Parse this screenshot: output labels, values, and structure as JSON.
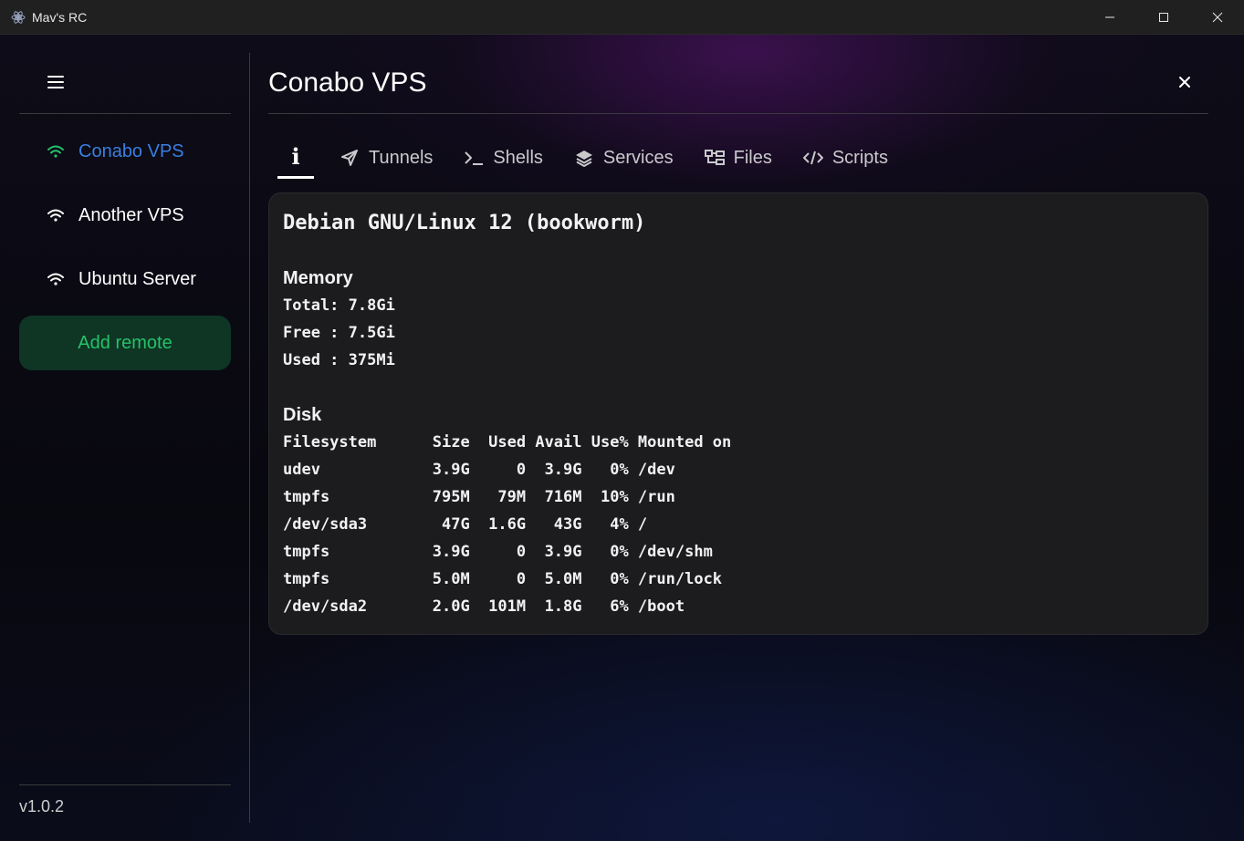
{
  "window": {
    "title": "Mav's RC"
  },
  "sidebar": {
    "items": [
      {
        "label": "Conabo VPS",
        "active": true
      },
      {
        "label": "Another VPS",
        "active": false
      },
      {
        "label": "Ubuntu Server",
        "active": false
      }
    ],
    "add_label": "Add remote",
    "version": "v1.0.2"
  },
  "main": {
    "title": "Conabo VPS",
    "tabs": [
      {
        "label": "i",
        "icon": "info-icon"
      },
      {
        "label": "Tunnels",
        "icon": "send-icon"
      },
      {
        "label": "Shells",
        "icon": "terminal-icon"
      },
      {
        "label": "Services",
        "icon": "layers-icon"
      },
      {
        "label": "Files",
        "icon": "folder-tree-icon"
      },
      {
        "label": "Scripts",
        "icon": "code-icon"
      }
    ],
    "info": {
      "os": "Debian GNU/Linux 12 (bookworm)",
      "memory_title": "Memory",
      "memory_lines": [
        "Total: 7.8Gi",
        "Free : 7.5Gi",
        "Used : 375Mi"
      ],
      "disk_title": "Disk",
      "disk_lines": [
        "Filesystem      Size  Used Avail Use% Mounted on",
        "udev            3.9G     0  3.9G   0% /dev",
        "tmpfs           795M   79M  716M  10% /run",
        "/dev/sda3        47G  1.6G   43G   4% /",
        "tmpfs           3.9G     0  3.9G   0% /dev/shm",
        "tmpfs           5.0M     0  5.0M   0% /run/lock",
        "/dev/sda2       2.0G  101M  1.8G   6% /boot"
      ]
    }
  },
  "colors": {
    "active_accent": "#3a7fe0",
    "active_wifi": "#26c26a",
    "add_button_bg": "#0f3524",
    "add_button_text": "#26c26a"
  }
}
